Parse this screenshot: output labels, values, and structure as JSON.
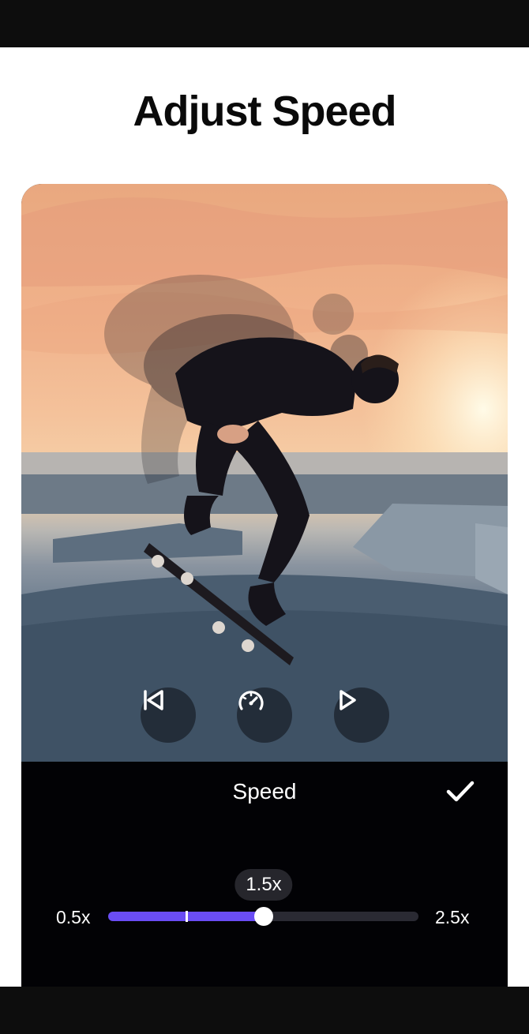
{
  "page": {
    "title": "Adjust Speed"
  },
  "player": {
    "controls": [
      {
        "name": "skip-to-start-icon"
      },
      {
        "name": "speedometer-icon"
      },
      {
        "name": "play-icon"
      }
    ]
  },
  "speed_panel": {
    "title": "Speed",
    "confirm_icon": "checkmark-icon",
    "slider": {
      "min_label": "0.5x",
      "max_label": "2.5x",
      "value_label": "1.5x",
      "min": 0.5,
      "max": 2.5,
      "value": 1.5,
      "default_value": 1.0
    }
  },
  "colors": {
    "accent": "#6a4df5",
    "panel_background": "#020205",
    "bubble_background": "#26262c"
  }
}
